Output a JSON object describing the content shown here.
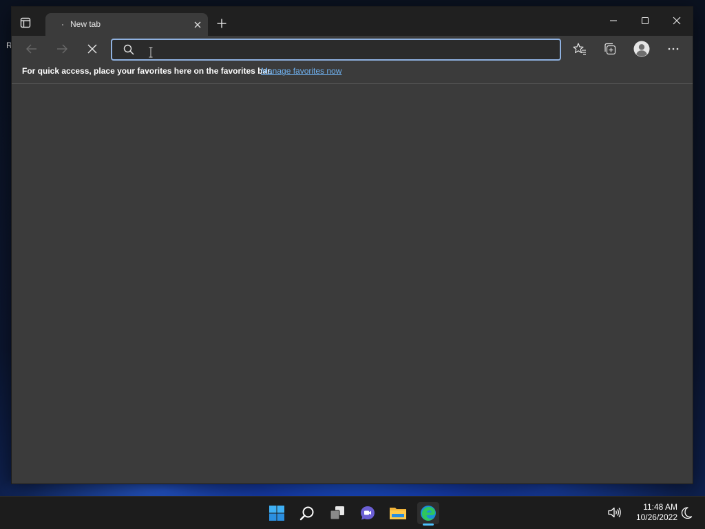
{
  "desktop": {
    "partial_label": "R"
  },
  "browser": {
    "tabs": [
      {
        "title": "New tab",
        "active": true,
        "loading": true
      }
    ],
    "address_bar": {
      "value": "",
      "placeholder": ""
    },
    "favorites_bar": {
      "message": "For quick access, place your favorites here on the favorites bar.",
      "link": "Manage favorites now"
    },
    "icons": {
      "tab_actions": "tab-actions-icon",
      "tab_close": "close-icon",
      "new_tab": "plus-icon",
      "minimize": "minimize-icon",
      "maximize": "maximize-icon",
      "close_window": "close-icon",
      "back": "back-arrow-icon",
      "forward": "forward-arrow-icon",
      "stop": "stop-loading-icon",
      "search": "search-icon",
      "favorites": "favorites-icon",
      "collections": "collections-icon",
      "profile": "profile-icon",
      "more": "more-options-icon"
    },
    "colors": {
      "frame": "#202020",
      "toolbar": "#3b3b3b",
      "address_border": "#8fb1e0",
      "link": "#6fb0ee"
    }
  },
  "taskbar": {
    "apps": [
      {
        "name": "Start",
        "icon": "windows-start-icon",
        "active": false
      },
      {
        "name": "Search",
        "icon": "search-icon",
        "active": false
      },
      {
        "name": "Task View",
        "icon": "task-view-icon",
        "active": false
      },
      {
        "name": "Chat",
        "icon": "chat-icon",
        "active": false
      },
      {
        "name": "File Explorer",
        "icon": "file-explorer-icon",
        "active": false
      },
      {
        "name": "Microsoft Edge",
        "icon": "edge-icon",
        "active": true
      }
    ],
    "tray": {
      "volume_icon": "volume-icon",
      "time": "11:48 AM",
      "date": "10/26/2022",
      "focus_icon": "focus-assist-icon"
    }
  }
}
